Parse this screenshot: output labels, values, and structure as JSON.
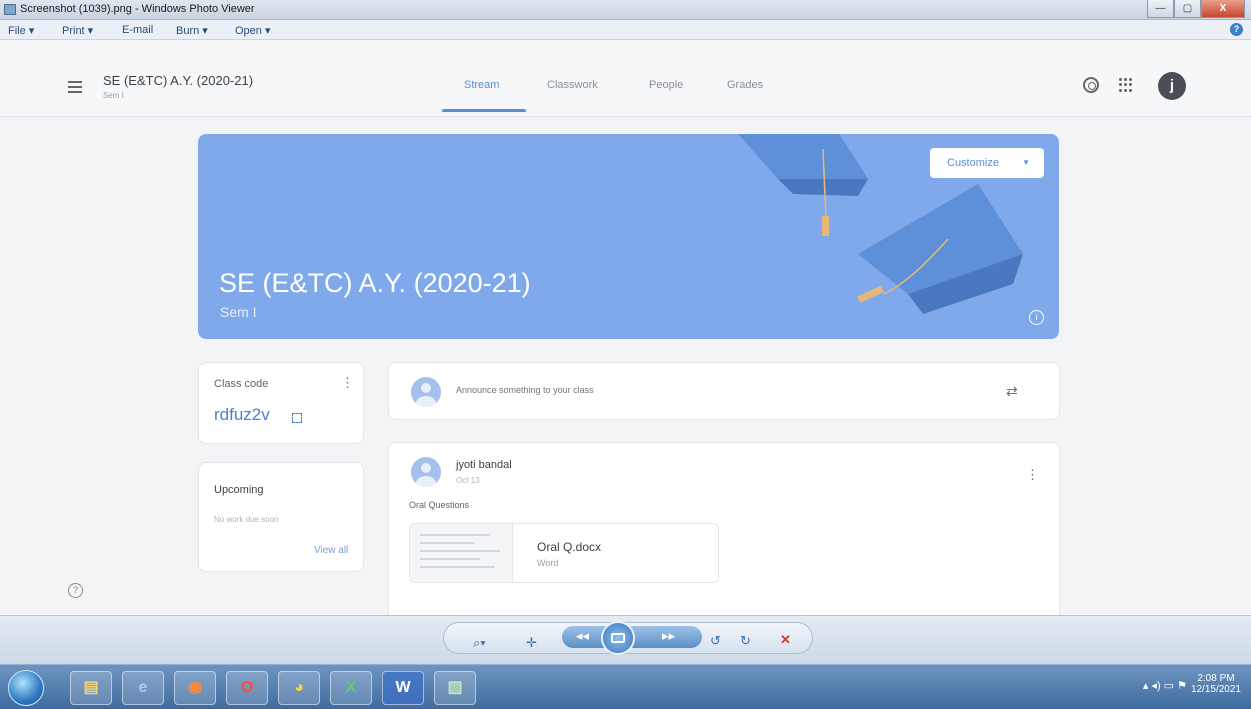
{
  "window": {
    "title": "Screenshot (1039).png - Windows Photo Viewer",
    "minimize": "—",
    "maximize": "▢",
    "close": "X",
    "menu": [
      "File ▾",
      "Print ▾",
      "E-mail",
      "Burn ▾",
      "Open ▾"
    ],
    "help": "?"
  },
  "classroom": {
    "header": {
      "title": "SE (E&TC) A.Y. (2020-21)",
      "subtitle": "Sem I",
      "tabs": [
        "Stream",
        "Classwork",
        "People",
        "Grades"
      ],
      "active_tab": "Stream",
      "avatar_letter": "j"
    },
    "banner": {
      "title": "SE (E&TC) A.Y. (2020-21)",
      "subtitle": "Sem I",
      "customize_label": "Customize",
      "info": "i",
      "color": "#7fa9ea"
    },
    "class_code": {
      "label": "Class code",
      "value": "rdfuz2v",
      "more": "⋮"
    },
    "upcoming": {
      "label": "Upcoming",
      "empty_text": "No work due soon",
      "link": "View all"
    },
    "announce": {
      "placeholder": "Announce something to your class"
    },
    "post": {
      "author": "jyoti bandal",
      "date": "Oct 13",
      "text": "Oral Questions",
      "more": "⋮",
      "attachment": {
        "name": "Oral Q.docx",
        "type": "Word"
      }
    },
    "help": "?"
  },
  "taskbar": {
    "time": "2:08 PM",
    "date": "12/15/2021"
  },
  "colors": {
    "accent": "#5b8fd8",
    "class_code": "#4a80d4",
    "close_red": "#d9382b"
  }
}
